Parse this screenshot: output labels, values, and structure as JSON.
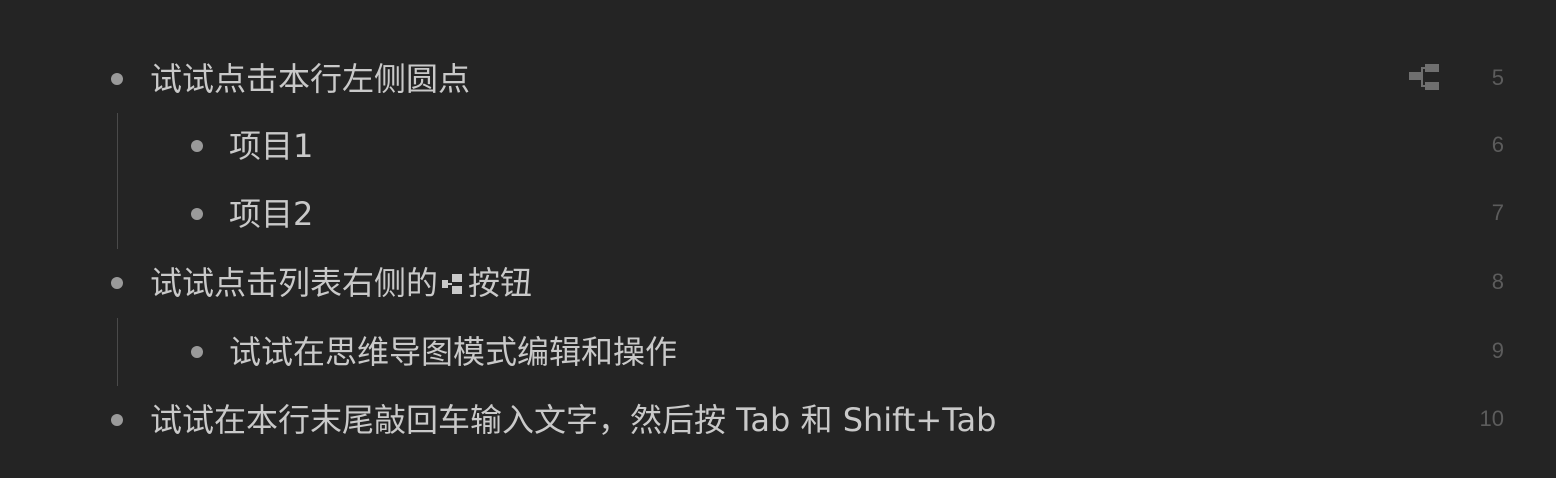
{
  "outline": {
    "rows": [
      {
        "text": "试试点击本行左侧圆点",
        "line": "5"
      },
      {
        "text": "项目1",
        "line": "6"
      },
      {
        "text": "项目2",
        "line": "7"
      },
      {
        "text_before": "试试点击列表右侧的",
        "text_after": "按钮",
        "icon": "mindmap-icon",
        "line": "8"
      },
      {
        "text": "试试在思维导图模式编辑和操作",
        "line": "9"
      },
      {
        "text": "试试在本行末尾敲回车输入文字，然后按 Tab 和 Shift+Tab",
        "line": "10"
      }
    ],
    "mindmap_button_icon": "mindmap-icon"
  },
  "colors": {
    "background": "#242424",
    "text": "#c9c9c9",
    "bullet": "#9a9a9a",
    "line_number": "#5c5c5c",
    "guide": "#4a4a4a",
    "icon": "#6f6f6f"
  }
}
